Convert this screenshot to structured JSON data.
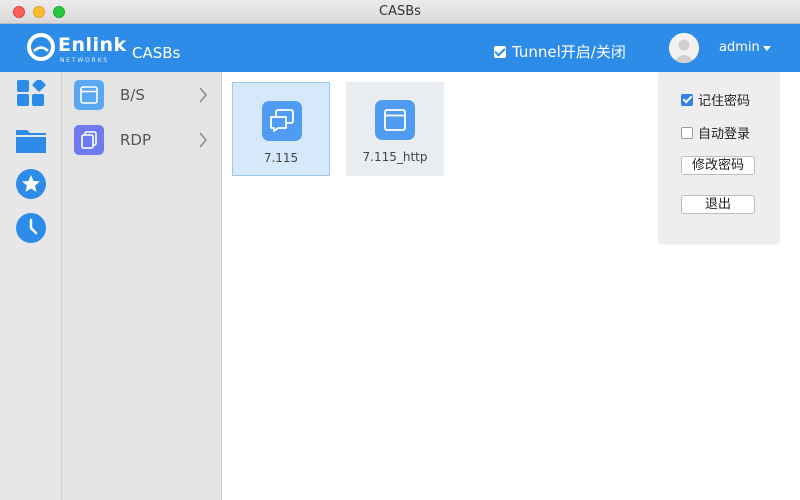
{
  "window": {
    "title": "CASBs"
  },
  "header": {
    "logo_text": "Enlink",
    "logo_sub": "NETWORKS",
    "app_name": "CASBs",
    "tunnel_label": "Tunnel开启/关闭",
    "tunnel_checked": true,
    "user_name": "admin"
  },
  "rail": {
    "items": [
      {
        "icon": "apps-grid-icon"
      },
      {
        "icon": "folder-icon"
      },
      {
        "icon": "star-icon"
      },
      {
        "icon": "clock-icon"
      }
    ]
  },
  "categories": [
    {
      "label": "B/S",
      "icon": "browser-window-icon",
      "color": "#5aa7f2"
    },
    {
      "label": "RDP",
      "icon": "copy-icon",
      "color": "#6e7bf0"
    }
  ],
  "apps": [
    {
      "label": "7.115",
      "icon": "chat-icon",
      "selected": true
    },
    {
      "label": "7.115_http",
      "icon": "browser-window-icon",
      "selected": false
    }
  ],
  "user_menu": {
    "remember_password": {
      "label": "记住密码",
      "checked": true
    },
    "auto_login": {
      "label": "自动登录",
      "checked": false
    },
    "change_password": "修改密码",
    "logout": "退出"
  },
  "colors": {
    "header": "#2d8ce8",
    "accent": "#2f7fe6",
    "tile_icon": "#4f9cf2"
  }
}
